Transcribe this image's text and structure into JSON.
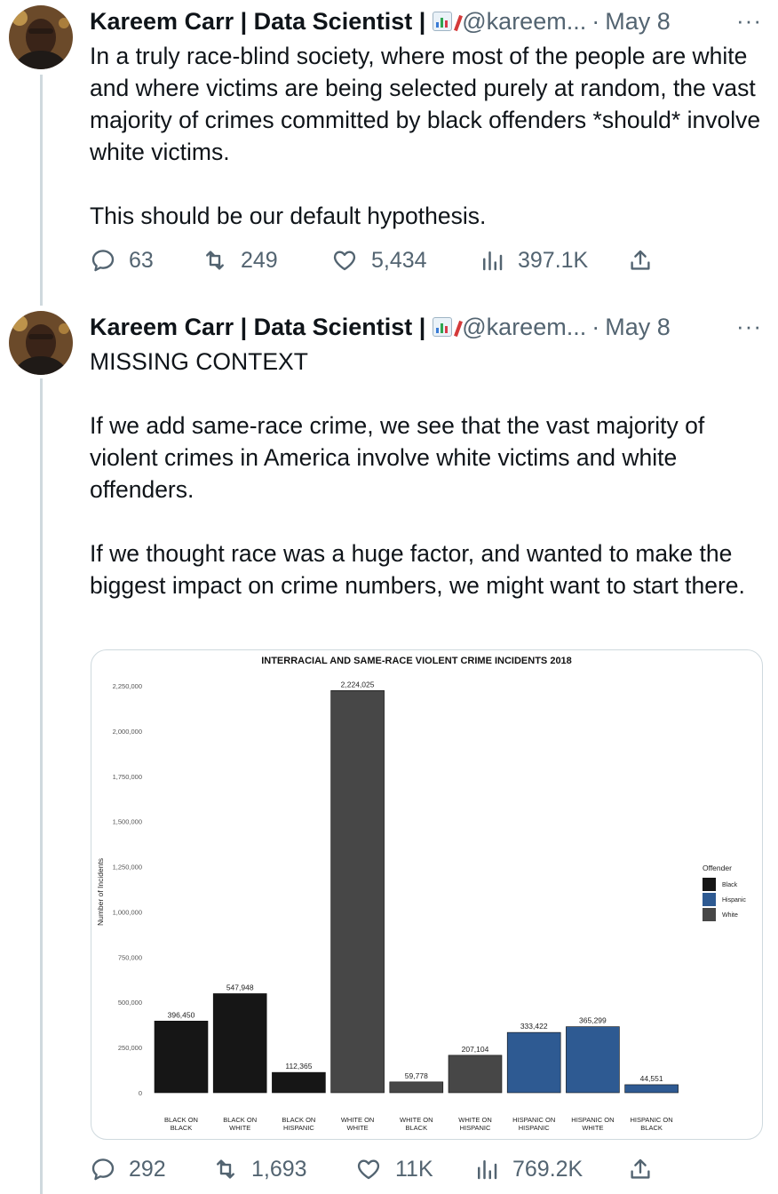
{
  "tweets": [
    {
      "author": "Kareem Carr | Data Scientist |",
      "handle": "@kareem...",
      "dot": "·",
      "date": "May 8",
      "more": "···",
      "text": "In a truly race-blind society, where most of the people are white and where victims are being selected purely at random, the vast majority of crimes committed by black offenders *should* involve white victims.\n\nThis should be our default hypothesis.",
      "replies": "63",
      "retweets": "249",
      "likes": "5,434",
      "views": "397.1K"
    },
    {
      "author": "Kareem Carr | Data Scientist |",
      "handle": "@kareem...",
      "dot": "·",
      "date": "May 8",
      "more": "···",
      "text": "MISSING CONTEXT\n\nIf we add same-race crime, we see that the vast majority of violent crimes in America involve white victims and white offenders.\n\nIf we thought race was a huge factor, and wanted to make the biggest impact on crime numbers, we might want to start there.",
      "replies": "292",
      "retweets": "1,693",
      "likes": "11K",
      "views": "769.2K"
    }
  ],
  "icons": {
    "reply": "reply-icon",
    "retweet": "retweet-icon",
    "like": "like-icon",
    "views": "views-icon",
    "share": "share-icon"
  },
  "colors": {
    "text": "#0f1419",
    "secondary": "#536471",
    "border": "#cfd9de"
  },
  "chart_data": {
    "type": "bar",
    "title": "INTERRACIAL AND SAME-RACE VIOLENT CRIME INCIDENTS 2018",
    "ylabel": "Number of Incidents",
    "xlabel": "",
    "ylim": [
      0,
      2250000
    ],
    "yticks": [
      0,
      250000,
      500000,
      750000,
      1000000,
      1250000,
      1500000,
      1750000,
      2000000,
      2250000
    ],
    "ytick_labels": [
      "0",
      "250,000",
      "500,000",
      "750,000",
      "1,000,000",
      "1,250,000",
      "1,500,000",
      "1,750,000",
      "2,000,000",
      "2,250,000"
    ],
    "grid": false,
    "categories": [
      [
        "BLACK ON",
        "BLACK"
      ],
      [
        "BLACK ON",
        "WHITE"
      ],
      [
        "BLACK ON",
        "HISPANIC"
      ],
      [
        "WHITE ON",
        "WHITE"
      ],
      [
        "WHITE ON",
        "BLACK"
      ],
      [
        "WHITE ON",
        "HISPANIC"
      ],
      [
        "HISPANIC ON",
        "HISPANIC"
      ],
      [
        "HISPANIC ON",
        "WHITE"
      ],
      [
        "HISPANIC ON",
        "BLACK"
      ]
    ],
    "values": [
      396450,
      547948,
      112365,
      2224025,
      59778,
      207104,
      333422,
      365299,
      44551
    ],
    "value_labels": [
      "396,450",
      "547,948",
      "112,365",
      "2,224,025",
      "59,778",
      "207,104",
      "333,422",
      "365,299",
      "44,551"
    ],
    "offender": [
      "Black",
      "Black",
      "Black",
      "White",
      "White",
      "White",
      "Hispanic",
      "Hispanic",
      "Hispanic"
    ],
    "legend": {
      "title": "Offender",
      "position": "right",
      "entries": [
        {
          "name": "Black",
          "color": "#161616"
        },
        {
          "name": "Hispanic",
          "color": "#2e5a92"
        },
        {
          "name": "White",
          "color": "#474747"
        }
      ]
    }
  }
}
